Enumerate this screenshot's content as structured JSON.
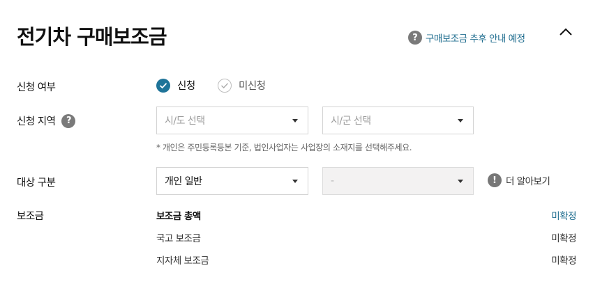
{
  "header": {
    "title": "전기차 구매보조금",
    "notice": "구매보조금 추후 안내 예정",
    "help_glyph": "?"
  },
  "form": {
    "apply": {
      "label": "신청 여부",
      "options": [
        {
          "label": "신청",
          "selected": true
        },
        {
          "label": "미신청",
          "selected": false
        }
      ]
    },
    "region": {
      "label": "신청 지역",
      "help_glyph": "?",
      "sido_placeholder": "시/도 선택",
      "sigun_placeholder": "시/군 선택",
      "hint": "* 개인은 주민등록등본 기준, 법인사업자는 사업장의 소재지를 선택해주세요."
    },
    "target": {
      "label": "대상 구분",
      "type_value": "개인 일반",
      "sub_value": "-",
      "more_glyph": "!",
      "more_label": "더 알아보기"
    },
    "subsidy": {
      "label": "보조금",
      "rows": [
        {
          "name": "보조금 총액",
          "value": "미확정"
        },
        {
          "name": "국고 보조금",
          "value": "미확정"
        },
        {
          "name": "지자체 보조금",
          "value": "미확정"
        }
      ]
    }
  },
  "colors": {
    "accent": "#1f7499",
    "link": "#1f6d8f",
    "icon_gray": "#7a7a7a"
  },
  "icons": {
    "help": "question-circle-icon",
    "collapse": "chevron-up-icon",
    "checked": "check-circle-icon",
    "unchecked": "check-outline-icon",
    "dropdown": "caret-down-icon",
    "info": "exclamation-circle-icon"
  }
}
